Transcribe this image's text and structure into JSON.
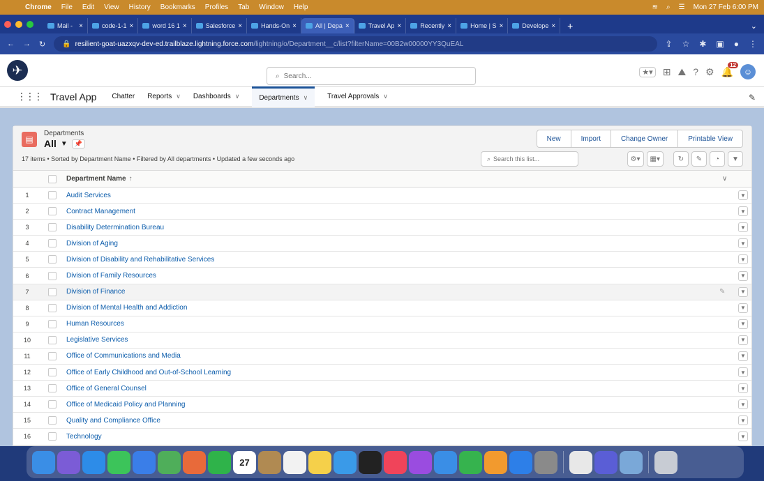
{
  "menubar": {
    "app": "Chrome",
    "items": [
      "File",
      "Edit",
      "View",
      "History",
      "Bookmarks",
      "Profiles",
      "Tab",
      "Window",
      "Help"
    ],
    "clock": "Mon 27 Feb 6:00 PM"
  },
  "browser": {
    "tabs": [
      {
        "label": "Mail -",
        "active": false
      },
      {
        "label": "code-1-1",
        "active": false
      },
      {
        "label": "word 16 1",
        "active": false
      },
      {
        "label": "Salesforce",
        "active": false
      },
      {
        "label": "Hands-On",
        "active": false
      },
      {
        "label": "All | Depa",
        "active": true
      },
      {
        "label": "Travel Ap",
        "active": false
      },
      {
        "label": "Recently",
        "active": false
      },
      {
        "label": "Home | S",
        "active": false
      },
      {
        "label": "Develope",
        "active": false
      }
    ],
    "url_main": "resilient-goat-uazxqv-dev-ed.trailblaze.lightning.force.com",
    "url_path": "/lightning/o/Department__c/list?filterName=00B2w00000YY3QuEAL"
  },
  "header": {
    "search_placeholder": "Search...",
    "notification_count": "12"
  },
  "nav": {
    "app_name": "Travel App",
    "items": [
      {
        "label": "Chatter",
        "dropdown": false,
        "active": false
      },
      {
        "label": "Reports",
        "dropdown": true,
        "active": false
      },
      {
        "label": "Dashboards",
        "dropdown": true,
        "active": false
      },
      {
        "label": "Departments",
        "dropdown": true,
        "active": true
      },
      {
        "label": "Travel Approvals",
        "dropdown": true,
        "active": false
      }
    ]
  },
  "list": {
    "object_label": "Departments",
    "view_name": "All",
    "buttons": [
      "New",
      "Import",
      "Change Owner",
      "Printable View"
    ],
    "meta": "17 items • Sorted by Department Name • Filtered by All departments • Updated a few seconds ago",
    "search_placeholder": "Search this list...",
    "column_header": "Department Name",
    "rows": [
      {
        "num": "1",
        "name": "Audit Services"
      },
      {
        "num": "2",
        "name": "Contract Management"
      },
      {
        "num": "3",
        "name": "Disability Determination Bureau"
      },
      {
        "num": "4",
        "name": "Division of Aging"
      },
      {
        "num": "5",
        "name": "Division of Disability and Rehabilitative Services"
      },
      {
        "num": "6",
        "name": "Division of Family Resources"
      },
      {
        "num": "7",
        "name": "Division of Finance"
      },
      {
        "num": "8",
        "name": "Division of Mental Health and Addiction"
      },
      {
        "num": "9",
        "name": "Human Resources"
      },
      {
        "num": "10",
        "name": "Legislative Services"
      },
      {
        "num": "11",
        "name": "Office of Communications and Media"
      },
      {
        "num": "12",
        "name": "Office of Early Childhood and Out-of-School Learning"
      },
      {
        "num": "13",
        "name": "Office of General Counsel"
      },
      {
        "num": "14",
        "name": "Office of Medicaid Policy and Planning"
      },
      {
        "num": "15",
        "name": "Quality and Compliance Office"
      },
      {
        "num": "16",
        "name": "Technology"
      }
    ]
  },
  "dock": {
    "calendar_day": "27",
    "apps": [
      {
        "name": "finder-icon",
        "color": "#3a8ee6"
      },
      {
        "name": "launchpad-icon",
        "color": "#7b5cd6"
      },
      {
        "name": "safari-icon",
        "color": "#2d8ce8"
      },
      {
        "name": "messages-icon",
        "color": "#3cc45a"
      },
      {
        "name": "mail-icon",
        "color": "#3a7ee8"
      },
      {
        "name": "maps-icon",
        "color": "#4fae5a"
      },
      {
        "name": "photos-icon",
        "color": "#e86a3a"
      },
      {
        "name": "facetime-icon",
        "color": "#2fb34a"
      },
      {
        "name": "calendar-icon",
        "color": "#ffffff"
      },
      {
        "name": "contacts-icon",
        "color": "#b08a52"
      },
      {
        "name": "reminders-icon",
        "color": "#f2f2f2"
      },
      {
        "name": "notes-icon",
        "color": "#f5d04a"
      },
      {
        "name": "freeform-icon",
        "color": "#3a9ae8"
      },
      {
        "name": "tv-icon",
        "color": "#222222"
      },
      {
        "name": "music-icon",
        "color": "#f0445a"
      },
      {
        "name": "podcasts-icon",
        "color": "#9a4ce0"
      },
      {
        "name": "keynote-icon",
        "color": "#3a8ee6"
      },
      {
        "name": "numbers-icon",
        "color": "#36b34e"
      },
      {
        "name": "pages-icon",
        "color": "#f29a2e"
      },
      {
        "name": "app-store-icon",
        "color": "#2d7fe8"
      },
      {
        "name": "system-settings-icon",
        "color": "#8a8a8a"
      },
      {
        "name": "chrome-icon",
        "color": "#e8e8e8"
      },
      {
        "name": "teams-icon",
        "color": "#5a5ed6"
      },
      {
        "name": "preview-icon",
        "color": "#7aa8d8"
      },
      {
        "name": "trash-icon",
        "color": "#c8ccd4"
      }
    ]
  },
  "colors": {
    "menubar": "#c98a2c",
    "link": "#0b5cab",
    "brand": "#1b5297",
    "object_icon": "#e96c60"
  }
}
